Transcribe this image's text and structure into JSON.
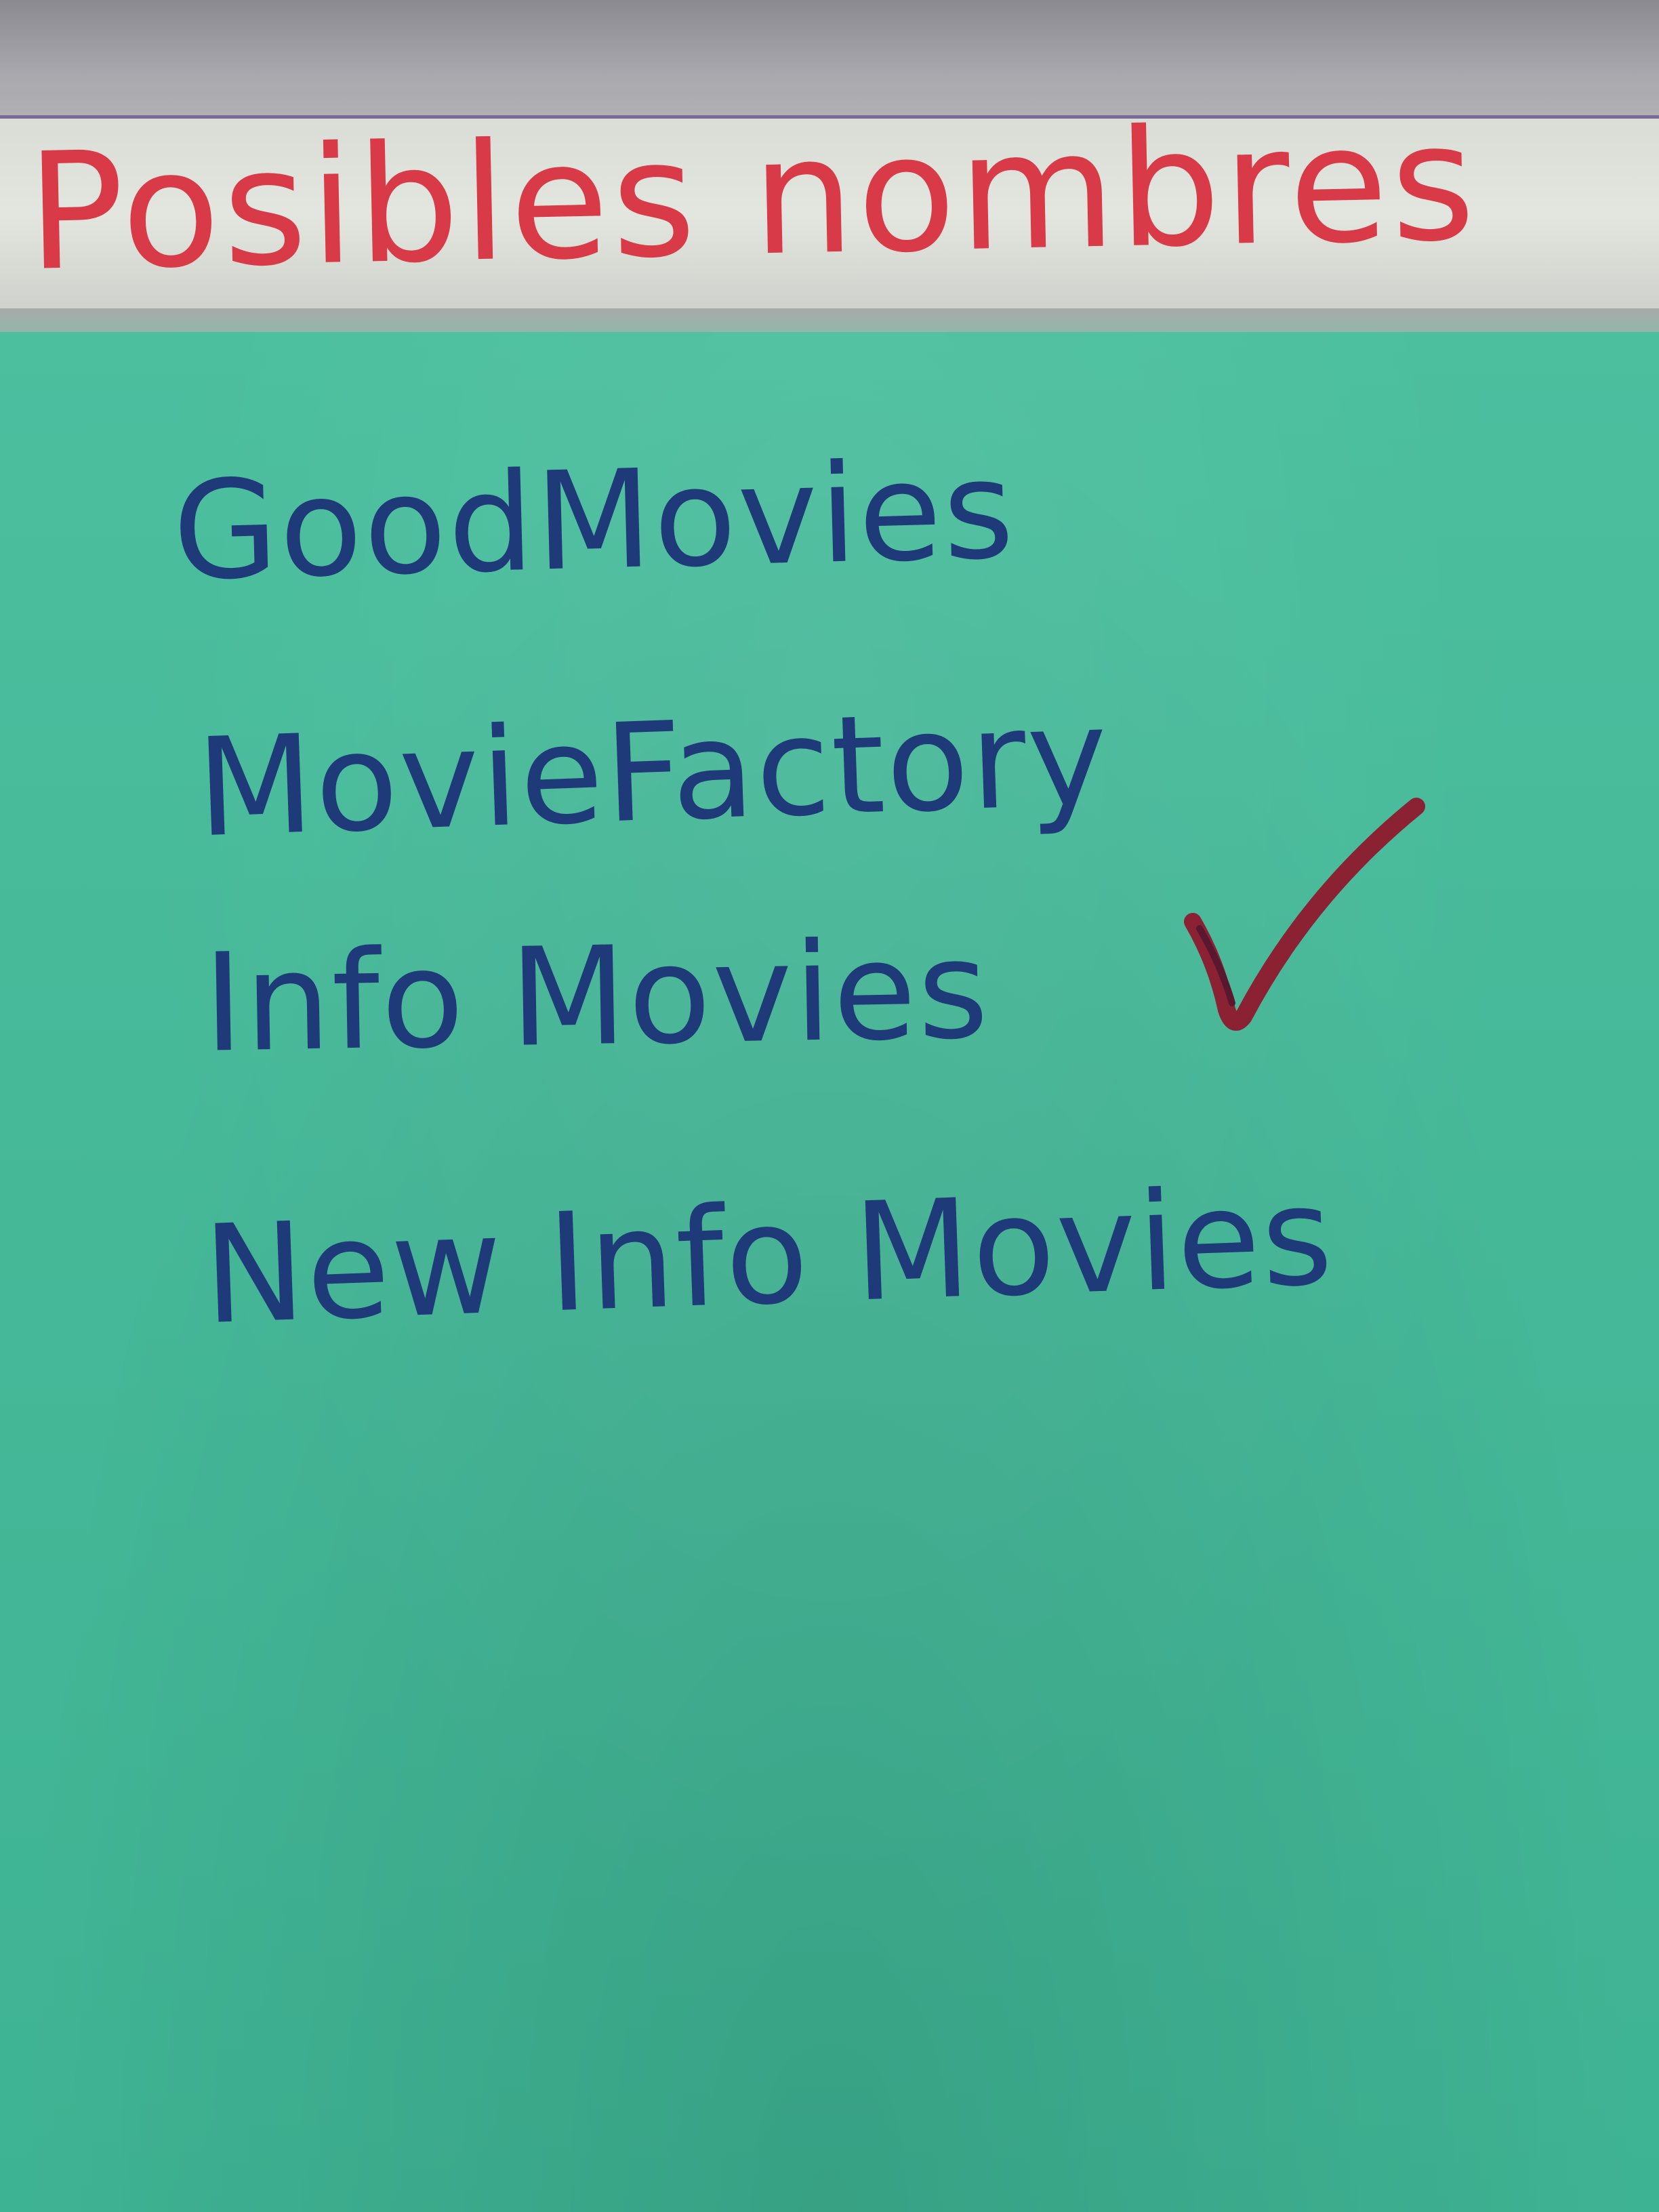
{
  "header": {
    "title": "Posibles nombres"
  },
  "names": [
    {
      "label": "GoodMovies"
    },
    {
      "label": "MovieFactory"
    },
    {
      "label": "Info Movies",
      "checked": true
    },
    {
      "label": "New Info Movies"
    }
  ],
  "colors": {
    "card": "#45b89a",
    "title_ink": "#d83a48",
    "name_ink": "#1f3a78",
    "checkmark": "#8a2233"
  },
  "icons": {
    "selected_mark": "checkmark-icon"
  }
}
